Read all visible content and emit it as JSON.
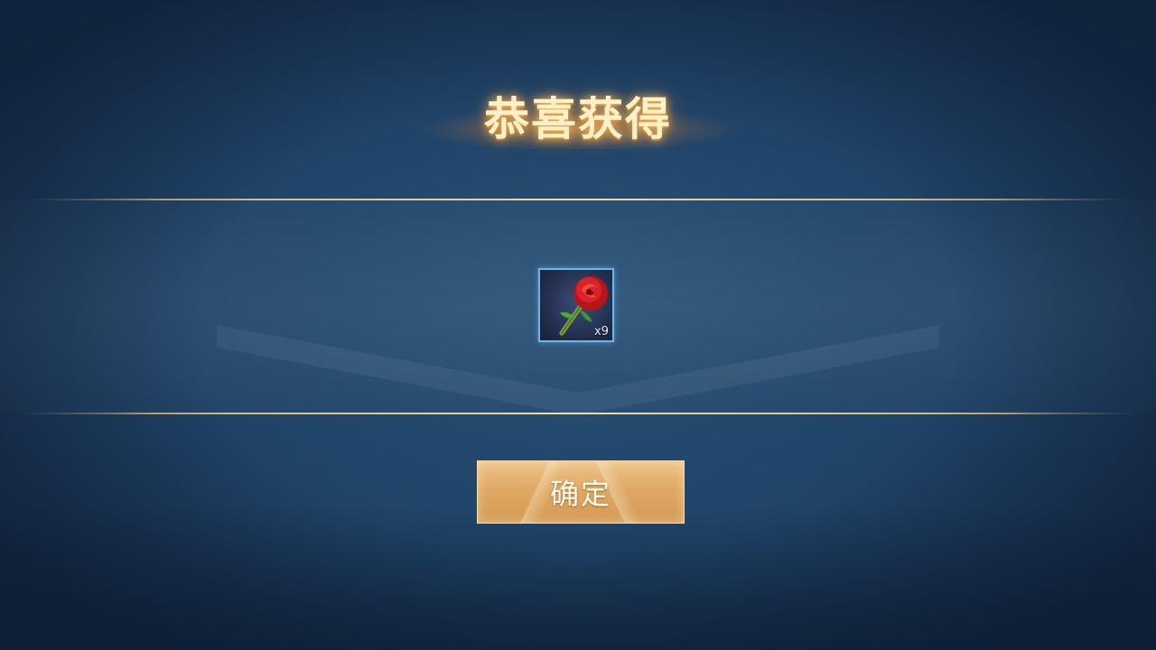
{
  "dialog": {
    "title": "恭喜获得",
    "reward": {
      "icon": "red-rose-icon",
      "count_label": "x9"
    },
    "confirm_label": "确定"
  },
  "colors": {
    "background": "#21456a",
    "title_text": "#fff0c8",
    "divider": "#f3d9a6",
    "slot_border": "#6fb4ea",
    "button": "#dfa965"
  }
}
